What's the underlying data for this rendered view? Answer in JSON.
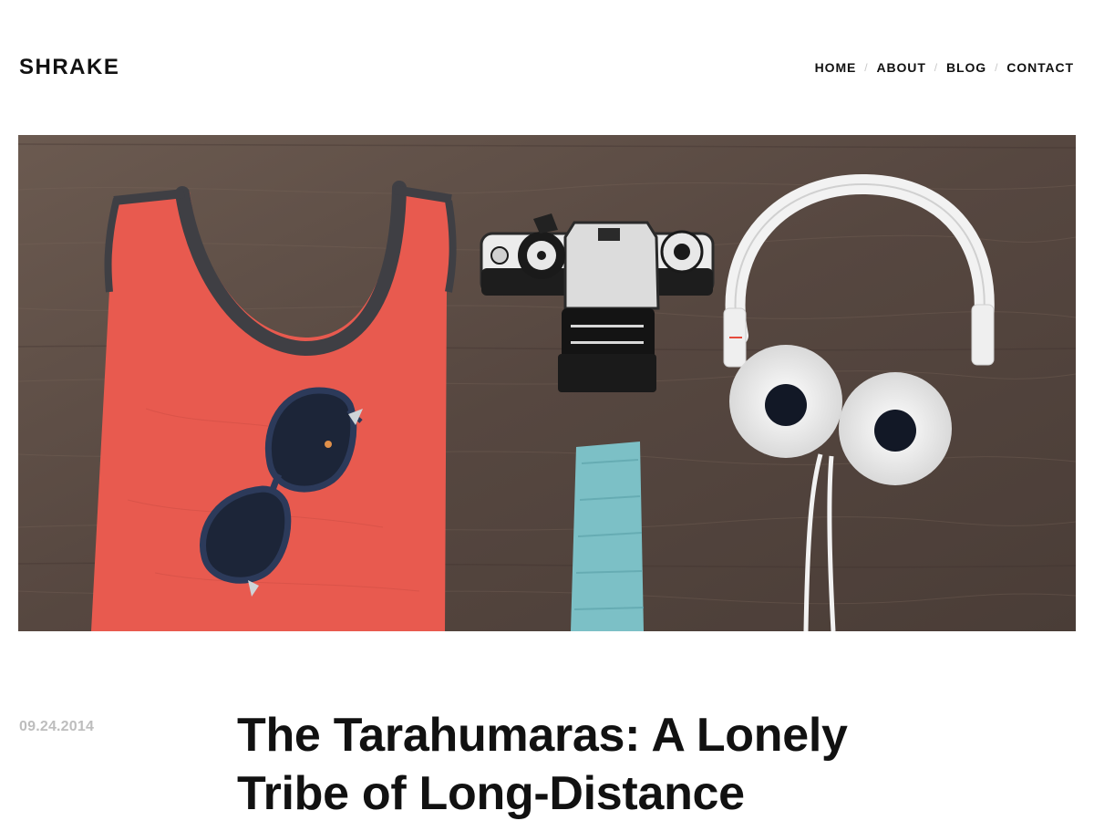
{
  "site": {
    "logo": "SHRAKE"
  },
  "nav": {
    "items": [
      {
        "label": "HOME"
      },
      {
        "label": "ABOUT"
      },
      {
        "label": "BLOG"
      },
      {
        "label": "CONTACT"
      }
    ],
    "separator": "/"
  },
  "hero": {
    "image_subject": "flat-lay: red tank top, sunglasses, film camera, blue wristband, white headphones on wood table",
    "colors": {
      "wood": "#5a4a40",
      "shirt": "#e85a4f",
      "trim": "#3f3f44",
      "lens": "#1c2538",
      "towel": "#7cc0c6",
      "headphones": "#f2f2f2"
    }
  },
  "post": {
    "date": "09.24.2014",
    "title": "The Tarahumaras: A Lonely Tribe of Long-Distance"
  }
}
